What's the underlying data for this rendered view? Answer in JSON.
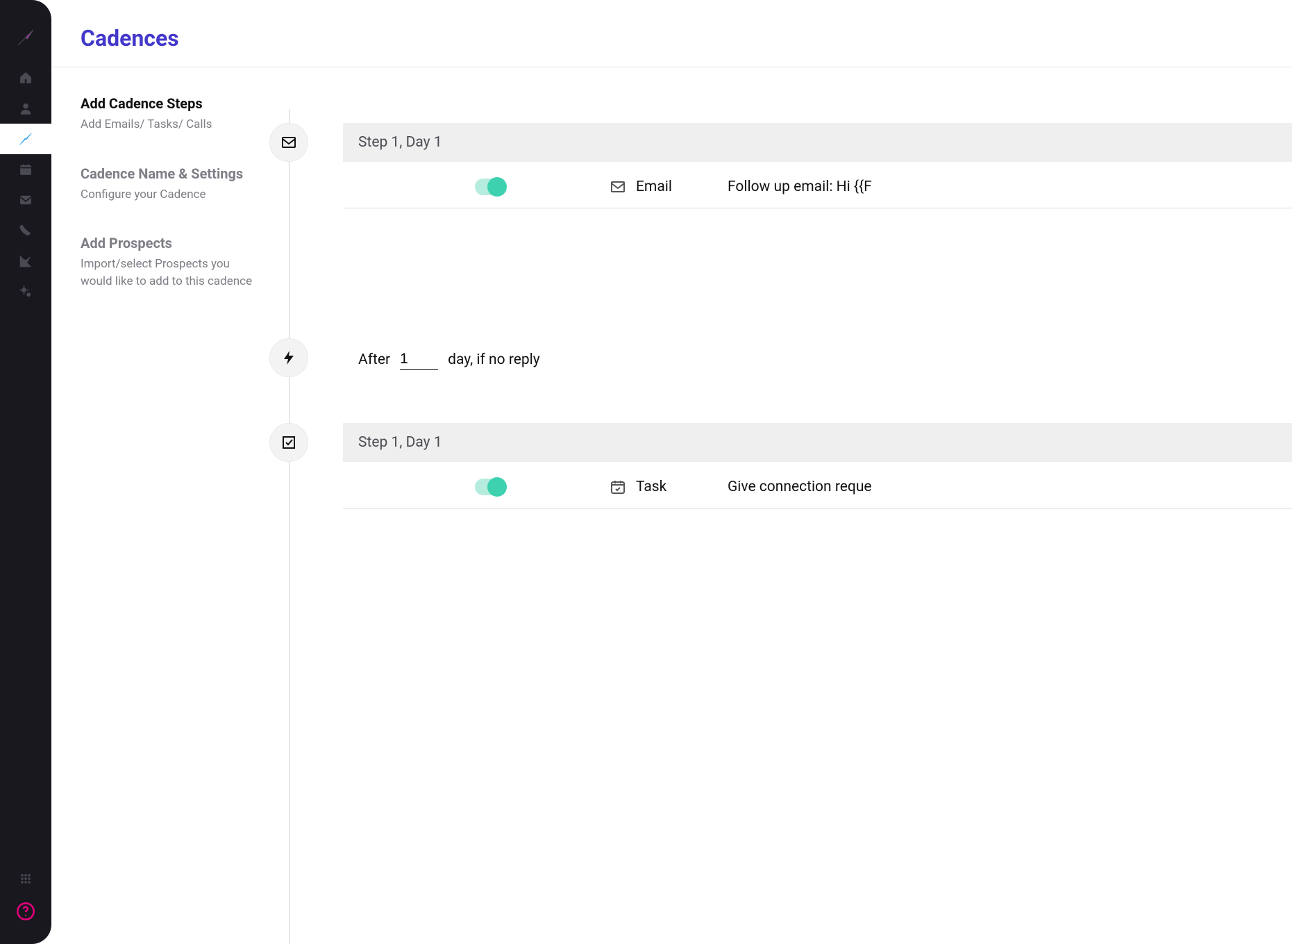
{
  "header": {
    "title": "Cadences"
  },
  "steps_sidebar": {
    "s1": {
      "title": "Add Cadence Steps",
      "subtitle": "Add Emails/ Tasks/ Calls"
    },
    "s2": {
      "title": "Cadence Name & Settings",
      "subtitle": "Configure your Cadence"
    },
    "s3": {
      "title": "Add Prospects",
      "subtitle": "Import/select Prospects you would like to add to this cadence"
    }
  },
  "timeline": {
    "step1": {
      "header": "Step 1, Day 1",
      "type_label": "Email",
      "description": "Follow up email: Hi {{F"
    },
    "delay": {
      "prefix": "After",
      "value": "1",
      "suffix": "day, if no reply"
    },
    "step2": {
      "header": "Step 1, Day 1",
      "type_label": "Task",
      "description": "Give connection reque"
    }
  }
}
